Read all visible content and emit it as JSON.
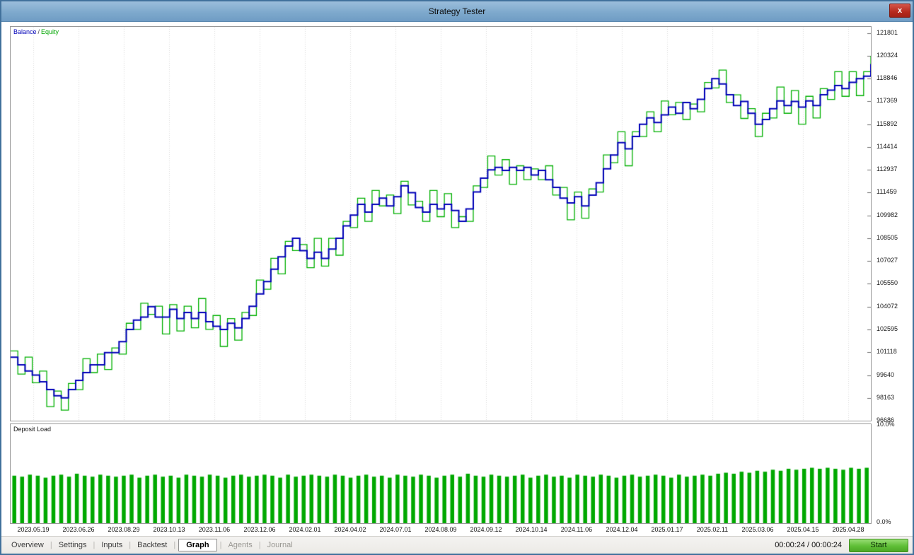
{
  "window": {
    "title": "Strategy Tester",
    "close_label": "x"
  },
  "legend": {
    "balance": "Balance",
    "separator": "/",
    "equity": "Equity"
  },
  "deposit_panel": {
    "label": "Deposit Load",
    "max_label": "10.0%",
    "min_label": "0.0%"
  },
  "tabs": [
    {
      "label": "Overview",
      "state": "normal"
    },
    {
      "label": "Settings",
      "state": "normal"
    },
    {
      "label": "Inputs",
      "state": "normal"
    },
    {
      "label": "Backtest",
      "state": "normal"
    },
    {
      "label": "Graph",
      "state": "active"
    },
    {
      "label": "Agents",
      "state": "muted"
    },
    {
      "label": "Journal",
      "state": "muted"
    }
  ],
  "statusbar": {
    "time": "00:00:24 / 00:00:24",
    "start_label": "Start"
  },
  "colors": {
    "balance_line": "#0000B8",
    "equity_line": "#00B000",
    "deposit_bar": "#00A800",
    "grid": "#DBDBDB",
    "titlebar": "#7EA9CD",
    "start_button_green": "#5FBE36",
    "close_red": "#B5291D"
  },
  "chart_data": {
    "main": {
      "type": "line",
      "title": "Balance / Equity",
      "ylim": [
        96686,
        122200
      ],
      "grid_color": "#DBDBDB",
      "y_ticks": [
        121801,
        120324,
        118846,
        117369,
        115892,
        114414,
        112937,
        111459,
        109982,
        108505,
        107027,
        105550,
        104072,
        102595,
        101118,
        99640,
        98163,
        96686
      ],
      "x_labels": [
        "2023.05.19",
        "2023.06.26",
        "2023.08.29",
        "2023.10.13",
        "2023.11.06",
        "2023.12.06",
        "2024.02.01",
        "2024.04.02",
        "2024.07.01",
        "2024.08.09",
        "2024.09.12",
        "2024.10.14",
        "2024.11.06",
        "2024.12.04",
        "2025.01.17",
        "2025.02.11",
        "2025.03.06",
        "2025.04.15",
        "2025.04.28"
      ],
      "series": [
        {
          "name": "Balance",
          "color": "#0000B8",
          "line_width": 2,
          "values": [
            100800,
            100300,
            99900,
            99640,
            99200,
            98700,
            98300,
            98163,
            98700,
            99300,
            99800,
            100300,
            100300,
            101100,
            101100,
            101800,
            102595,
            103200,
            103400,
            104072,
            103400,
            103400,
            103900,
            103300,
            103700,
            103300,
            103700,
            103100,
            102800,
            102595,
            103000,
            102700,
            103300,
            104100,
            104900,
            105700,
            106500,
            107300,
            108000,
            108505,
            107700,
            107200,
            107600,
            107200,
            107800,
            108505,
            109300,
            110000,
            110700,
            110200,
            110700,
            111100,
            110600,
            111200,
            111900,
            111459,
            110500,
            110200,
            110700,
            110400,
            110700,
            110300,
            109600,
            110400,
            111500,
            112400,
            112937,
            113100,
            112900,
            113100,
            112900,
            113100,
            112600,
            112900,
            112300,
            111800,
            111100,
            110800,
            111200,
            110600,
            111300,
            112100,
            113000,
            113900,
            114700,
            114300,
            115100,
            115892,
            116300,
            116000,
            116500,
            117000,
            116600,
            117300,
            116900,
            117500,
            118200,
            118846,
            118500,
            117800,
            117100,
            117369,
            116600,
            115892,
            116200,
            116900,
            117400,
            117100,
            117369,
            117000,
            117400,
            117100,
            117800,
            118100,
            118400,
            118200,
            118600,
            118846,
            119000,
            119800
          ]
        },
        {
          "name": "Equity",
          "color": "#00B000",
          "line_width": 1.3,
          "values": [
            101200,
            99700,
            100800,
            99140,
            99900,
            97600,
            98600,
            97363,
            99100,
            98700,
            100700,
            99800,
            101000,
            100000,
            101400,
            101000,
            102995,
            102600,
            104300,
            103572,
            104100,
            102300,
            104200,
            102500,
            104100,
            102700,
            104600,
            102600,
            103500,
            101495,
            103300,
            101900,
            103700,
            103500,
            105800,
            105200,
            107200,
            106200,
            108300,
            107705,
            108100,
            106600,
            108500,
            106700,
            108500,
            107405,
            109600,
            109200,
            111100,
            109600,
            111600,
            110600,
            111300,
            110100,
            112200,
            110659,
            110900,
            109600,
            111600,
            109900,
            111400,
            109200,
            109900,
            109600,
            111900,
            111800,
            113837,
            112600,
            113600,
            112000,
            113200,
            112300,
            113000,
            112300,
            113200,
            111300,
            111800,
            109700,
            111500,
            109800,
            111700,
            111500,
            113900,
            113400,
            115400,
            113200,
            115400,
            115092,
            116700,
            115400,
            117400,
            116500,
            117300,
            116200,
            117200,
            116700,
            118600,
            118246,
            119400,
            117300,
            117800,
            116269,
            116900,
            115092,
            116600,
            116300,
            118300,
            116600,
            118069,
            115900,
            117700,
            116300,
            118200,
            117500,
            119300,
            117700,
            119300,
            117746,
            119300,
            120324
          ]
        }
      ]
    },
    "deposit": {
      "type": "bar",
      "title": "Deposit Load",
      "ylim": [
        0,
        10
      ],
      "ylabel_top": "10.0%",
      "ylabel_bottom": "0.0%",
      "bar_color": "#00A800",
      "values": [
        4.8,
        4.7,
        4.9,
        4.8,
        4.6,
        4.8,
        4.9,
        4.7,
        5.0,
        4.8,
        4.7,
        4.9,
        4.8,
        4.7,
        4.8,
        4.9,
        4.6,
        4.8,
        4.9,
        4.7,
        4.8,
        4.6,
        4.9,
        4.8,
        4.7,
        4.9,
        4.8,
        4.6,
        4.8,
        4.9,
        4.7,
        4.8,
        4.9,
        4.8,
        4.6,
        4.9,
        4.7,
        4.8,
        4.9,
        4.8,
        4.7,
        4.9,
        4.8,
        4.6,
        4.8,
        4.9,
        4.7,
        4.8,
        4.6,
        4.9,
        4.8,
        4.7,
        4.9,
        4.8,
        4.6,
        4.8,
        4.9,
        4.7,
        5.0,
        4.8,
        4.7,
        4.9,
        4.8,
        4.7,
        4.8,
        4.9,
        4.6,
        4.8,
        4.9,
        4.7,
        4.8,
        4.6,
        4.9,
        4.8,
        4.7,
        4.9,
        4.8,
        4.6,
        4.8,
        4.9,
        4.7,
        4.8,
        4.9,
        4.8,
        4.6,
        4.9,
        4.7,
        4.8,
        4.9,
        4.8,
        5.0,
        5.1,
        5.0,
        5.2,
        5.1,
        5.3,
        5.2,
        5.4,
        5.3,
        5.5,
        5.4,
        5.5,
        5.6,
        5.5,
        5.6,
        5.5,
        5.4,
        5.6,
        5.5,
        5.6
      ]
    }
  }
}
